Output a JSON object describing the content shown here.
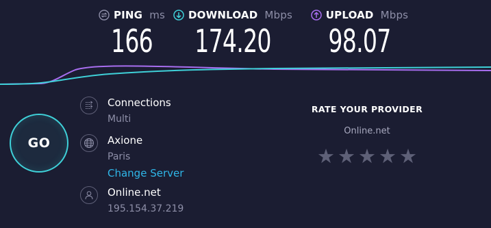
{
  "metrics": {
    "ping": {
      "label": "PING",
      "unit": "ms",
      "value": "166"
    },
    "download": {
      "label": "DOWNLOAD",
      "unit": "Mbps",
      "value": "174.20"
    },
    "upload": {
      "label": "UPLOAD",
      "unit": "Mbps",
      "value": "98.07"
    }
  },
  "go_button": {
    "label": "GO"
  },
  "connections": {
    "title": "Connections",
    "value": "Multi"
  },
  "server": {
    "title": "Axione",
    "location": "Paris",
    "change_label": "Change Server"
  },
  "host": {
    "title": "Online.net",
    "ip": "195.154.37.219"
  },
  "rating": {
    "title": "RATE YOUR PROVIDER",
    "provider": "Online.net",
    "stars_total": 5,
    "stars_filled": 0
  },
  "colors": {
    "background": "#1b1d32",
    "download": "#3fd1d9",
    "upload": "#a86ef0",
    "link": "#2fb6e8",
    "muted": "#8e8fa8"
  }
}
